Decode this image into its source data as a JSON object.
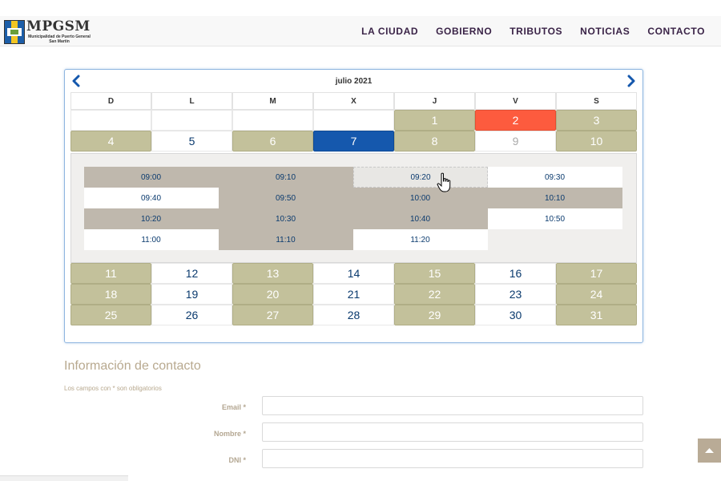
{
  "logo": {
    "title": "MPGSM",
    "subtitle": "Municipalidad de Puerto General San Martín"
  },
  "nav": [
    {
      "label": "LA CIUDAD"
    },
    {
      "label": "GOBIERNO"
    },
    {
      "label": "TRIBUTOS"
    },
    {
      "label": "NOTICIAS"
    },
    {
      "label": "CONTACTO"
    }
  ],
  "calendar": {
    "month_label": "julio 2021",
    "weekdays": [
      "D",
      "L",
      "M",
      "X",
      "J",
      "V",
      "S"
    ],
    "rows_top": [
      [
        {
          "day": "",
          "state": "empty"
        },
        {
          "day": "",
          "state": "empty"
        },
        {
          "day": "",
          "state": "empty"
        },
        {
          "day": "",
          "state": "empty"
        },
        {
          "day": "1",
          "state": "av"
        },
        {
          "day": "2",
          "state": "today"
        },
        {
          "day": "3",
          "state": "av"
        }
      ],
      [
        {
          "day": "4",
          "state": "av"
        },
        {
          "day": "5",
          "state": "open"
        },
        {
          "day": "6",
          "state": "av"
        },
        {
          "day": "7",
          "state": "sel"
        },
        {
          "day": "8",
          "state": "av"
        },
        {
          "day": "9",
          "state": "dis"
        },
        {
          "day": "10",
          "state": "av"
        }
      ]
    ],
    "rows_bottom": [
      [
        {
          "day": "11",
          "state": "av"
        },
        {
          "day": "12",
          "state": "open"
        },
        {
          "day": "13",
          "state": "av"
        },
        {
          "day": "14",
          "state": "open"
        },
        {
          "day": "15",
          "state": "av"
        },
        {
          "day": "16",
          "state": "open"
        },
        {
          "day": "17",
          "state": "av"
        }
      ],
      [
        {
          "day": "18",
          "state": "av"
        },
        {
          "day": "19",
          "state": "open"
        },
        {
          "day": "20",
          "state": "av"
        },
        {
          "day": "21",
          "state": "open"
        },
        {
          "day": "22",
          "state": "av"
        },
        {
          "day": "23",
          "state": "open"
        },
        {
          "day": "24",
          "state": "av"
        }
      ],
      [
        {
          "day": "25",
          "state": "av"
        },
        {
          "day": "26",
          "state": "open"
        },
        {
          "day": "27",
          "state": "av"
        },
        {
          "day": "28",
          "state": "open"
        },
        {
          "day": "29",
          "state": "av"
        },
        {
          "day": "30",
          "state": "open"
        },
        {
          "day": "31",
          "state": "av"
        }
      ]
    ],
    "slots": [
      {
        "time": "09:00",
        "state": "busy"
      },
      {
        "time": "09:10",
        "state": "busy"
      },
      {
        "time": "09:20",
        "state": "hover"
      },
      {
        "time": "09:30",
        "state": "free"
      },
      {
        "time": "09:40",
        "state": "free"
      },
      {
        "time": "09:50",
        "state": "busy"
      },
      {
        "time": "10:00",
        "state": "busy"
      },
      {
        "time": "10:10",
        "state": "busy"
      },
      {
        "time": "10:20",
        "state": "busy"
      },
      {
        "time": "10:30",
        "state": "busy"
      },
      {
        "time": "10:40",
        "state": "busy"
      },
      {
        "time": "10:50",
        "state": "free"
      },
      {
        "time": "11:00",
        "state": "free"
      },
      {
        "time": "11:10",
        "state": "busy"
      },
      {
        "time": "11:20",
        "state": "free"
      }
    ]
  },
  "form": {
    "title": "Información de contacto",
    "note": "Los campos con * son obligatorios",
    "fields": [
      {
        "label": "Email *",
        "value": ""
      },
      {
        "label": "Nombre *",
        "value": ""
      },
      {
        "label": "DNI *",
        "value": ""
      }
    ]
  },
  "colors": {
    "available": "#c3c19b",
    "today": "#fd5b3e",
    "selected": "#1558ad",
    "busy_slot": "#bfb8ad",
    "accent_text": "#0a3a6e"
  }
}
